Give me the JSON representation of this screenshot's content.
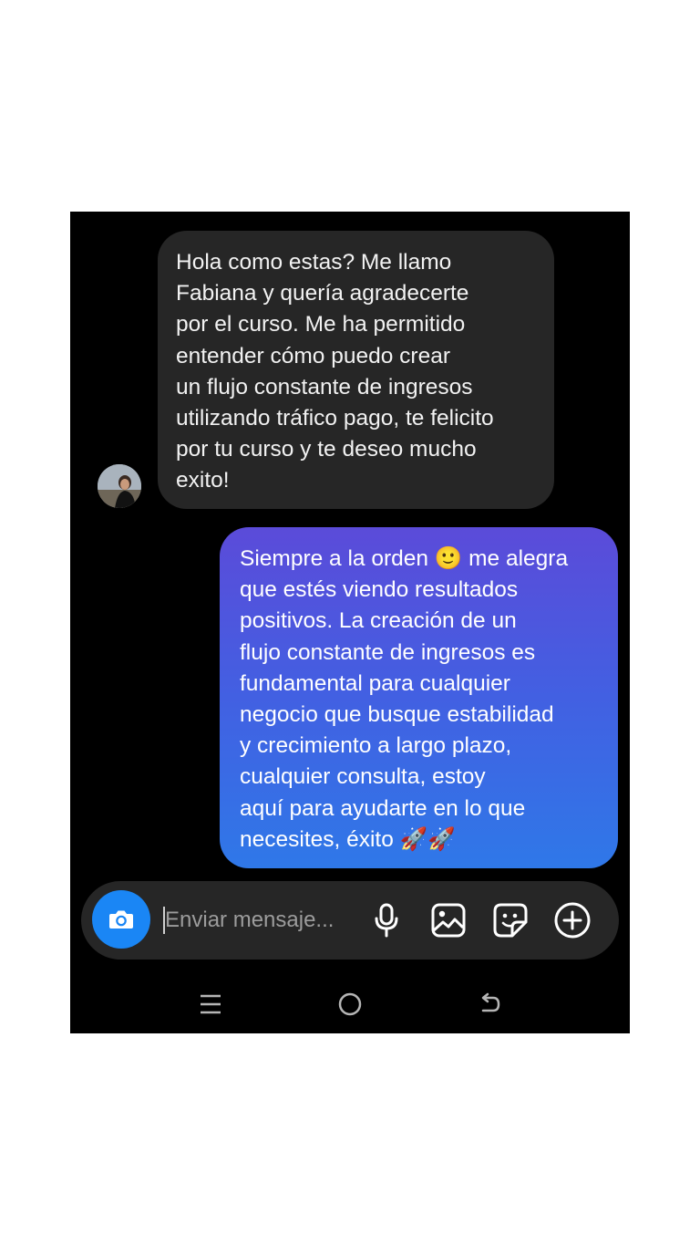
{
  "incoming_message": {
    "lines": [
      "Hola como estas? Me llamo",
      "Fabiana y quería agradecerte",
      "por el curso. Me ha permitido",
      "entender cómo puedo crear",
      "un flujo constante de ingresos",
      "utilizando tráfico pago, te felicito",
      "por tu curso y te deseo mucho",
      "exito!"
    ]
  },
  "outgoing_message": {
    "lines": [
      "Siempre a la orden 🙂 me alegra",
      "que estés viendo resultados",
      "positivos. La creación de un",
      "flujo constante de ingresos es",
      "fundamental para cualquier",
      "negocio que busque estabilidad",
      "y crecimiento a largo plazo,",
      "cualquier consulta, estoy",
      "aquí para ayudarte en lo que",
      "necesites, éxito 🚀🚀"
    ]
  },
  "composer": {
    "placeholder": "Enviar mensaje...",
    "icons": [
      "camera-icon",
      "microphone-icon",
      "gallery-icon",
      "sticker-icon",
      "add-icon"
    ],
    "camera_button_color": "#1a86f5"
  },
  "nav": {
    "icons": [
      "recent-apps-icon",
      "home-icon",
      "back-icon"
    ]
  },
  "colors": {
    "incoming_bubble": "#262626",
    "outgoing_gradient_top": "#5b4bd9",
    "outgoing_gradient_bottom": "#2f78e8",
    "background": "#000000"
  }
}
